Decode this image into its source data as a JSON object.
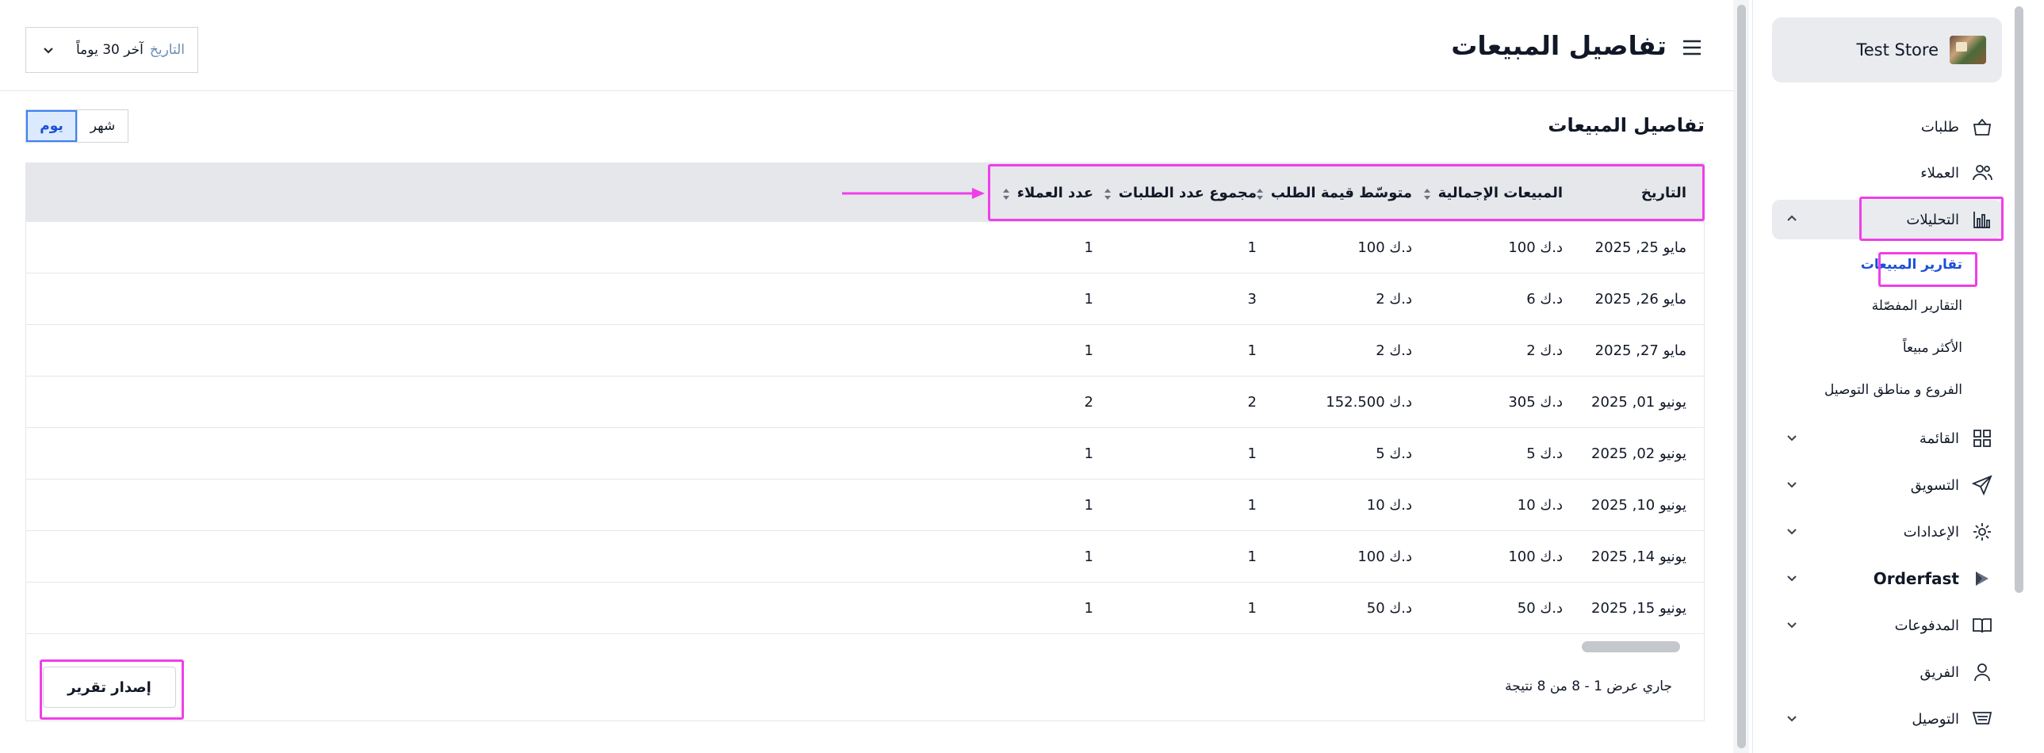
{
  "sidebar": {
    "store_name": "Test Store",
    "items": [
      {
        "label": "طلبات",
        "icon": "shopping-bag-icon"
      },
      {
        "label": "العملاء",
        "icon": "users-icon"
      },
      {
        "label": "التحليلات",
        "icon": "bar-chart-icon",
        "expanded": true
      },
      {
        "label": "القائمة",
        "icon": "grid-icon"
      },
      {
        "label": "التسويق",
        "icon": "send-icon"
      },
      {
        "label": "الإعدادات",
        "icon": "gear-icon"
      },
      {
        "label": "Orderfast",
        "icon": "play-icon"
      },
      {
        "label": "المدفوعات",
        "icon": "book-icon"
      },
      {
        "label": "الفريق",
        "icon": "user-icon"
      },
      {
        "label": "التوصيل",
        "icon": "delivery-icon"
      }
    ],
    "analytics_sub": [
      {
        "label": "تقارير المبيعات",
        "active": true
      },
      {
        "label": "التقارير المفصّلة"
      },
      {
        "label": "الأكثر مبيعاً"
      },
      {
        "label": "الفروع و مناطق التوصيل"
      }
    ]
  },
  "header": {
    "title": "تفاصيل المبيعات",
    "date_filter_label": "التاريخ",
    "date_filter_value": "آخر 30 يوماً"
  },
  "section": {
    "title": "تفاصيل المبيعات",
    "toggle": {
      "day": "يوم",
      "month": "شهر",
      "selected": "day"
    }
  },
  "table": {
    "columns": [
      "التاريخ",
      "المبيعات الإجمالية",
      "متوسّط قيمة الطلب",
      "مجموع عدد الطلبات",
      "عدد العملاء"
    ],
    "rows": [
      [
        "مايو 25, 2025",
        "د.ك 100",
        "د.ك 100",
        "1",
        "1"
      ],
      [
        "مايو 26, 2025",
        "د.ك 6",
        "د.ك 2",
        "3",
        "1"
      ],
      [
        "مايو 27, 2025",
        "د.ك 2",
        "د.ك 2",
        "1",
        "1"
      ],
      [
        "يونيو 01, 2025",
        "د.ك 305",
        "د.ك 152.500",
        "2",
        "2"
      ],
      [
        "يونيو 02, 2025",
        "د.ك 5",
        "د.ك 5",
        "1",
        "1"
      ],
      [
        "يونيو 10, 2025",
        "د.ك 10",
        "د.ك 10",
        "1",
        "1"
      ],
      [
        "يونيو 14, 2025",
        "د.ك 100",
        "د.ك 100",
        "1",
        "1"
      ],
      [
        "يونيو 15, 2025",
        "د.ك 50",
        "د.ك 50",
        "1",
        "1"
      ]
    ]
  },
  "footer": {
    "results_text": "جاري عرض 1 - 8 من 8 نتيجة",
    "export_label": "إصدار تقرير"
  },
  "colors": {
    "highlight": "#ef3fe8",
    "accent": "#1d4ed8",
    "header_bg": "#e5e7eb"
  }
}
